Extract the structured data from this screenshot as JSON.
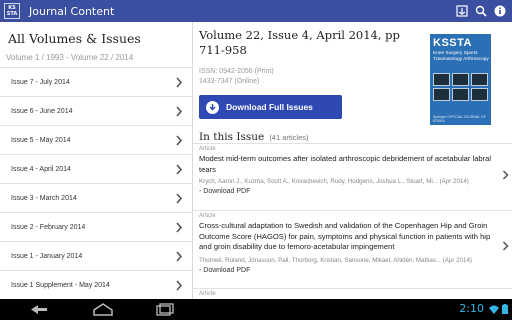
{
  "app": {
    "logo_line1": "KS",
    "logo_line2": "STA",
    "title": "Journal Content"
  },
  "actionbar": {
    "icons": [
      "library-icon",
      "search-icon",
      "info-icon"
    ]
  },
  "left": {
    "title": "All Volumes & Issues",
    "subtitle": "Volume 1 / 1993 - Volume 22 / 2014",
    "issues": [
      {
        "label": "Issue 7 - July 2014"
      },
      {
        "label": "Issue 6 - June 2014"
      },
      {
        "label": "Issue 5 - May 2014"
      },
      {
        "label": "Issue 4 - April 2014"
      },
      {
        "label": "Issue 3 - March 2014"
      },
      {
        "label": "Issue 2 - February 2014"
      },
      {
        "label": "Issue 1 - January 2014"
      },
      {
        "label": "Issue 1 Supplement - May 2014"
      }
    ]
  },
  "issue": {
    "title": "Volume 22, Issue 4, April 2014, pp 711-958",
    "issn_print": "ISSN: 0942-2056 (Print)",
    "issn_online": "1433-7347 (Online)",
    "download_label": "Download Full Issues",
    "in_issue_title": "In this Issue",
    "in_issue_count": "(41 articles)"
  },
  "cover": {
    "brand": "KSSTA",
    "subtitle": "Knee Surgery Sports Traumatology Arthroscopy",
    "footer": "Springer   OFFICIAL JOURNAL OF ESSKA"
  },
  "articles": [
    {
      "type": "Article",
      "title": "Modest mid-term outcomes after isolated arthroscopic debridement of acetabular labral tears",
      "authors": "Krych, Aaron J., Kuzma, Scott A., Kovachevich, Rudy, Hudgens, Joshua L., Stuart, Mi... (Apr 2014)",
      "download": "- Download PDF"
    },
    {
      "type": "Article",
      "title": "Cross-cultural adaptation to Swedish and validation of the Copenhagen Hip and Groin Outcome Score (HAGOS) for pain, symptoms and physical function in patients with hip and groin disability due to femoro-acetabular impingement",
      "authors": "Thomeé, Roland, Jónasson, Pall, Thorborg, Kristian, Sansone, Mikael, Ahldén, Mattias... (Apr 2014)",
      "download": "- Download PDF"
    },
    {
      "type": "Article"
    }
  ],
  "sysbar": {
    "time": "2:10"
  }
}
